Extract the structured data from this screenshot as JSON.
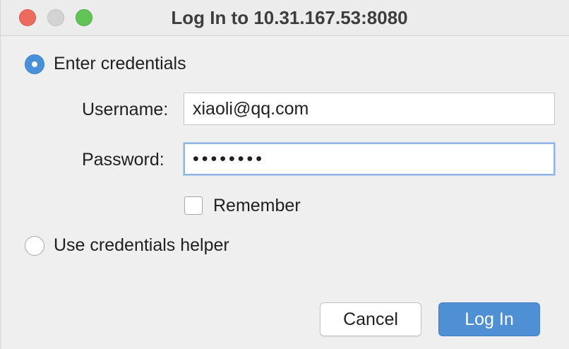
{
  "window": {
    "title": "Log In to 10.31.167.53:8080"
  },
  "auth_mode": {
    "enter_credentials_label": "Enter credentials",
    "enter_credentials_selected": true,
    "helper_label": "Use credentials helper",
    "helper_selected": false
  },
  "form": {
    "username_label": "Username:",
    "username_value": "xiaoli@qq.com",
    "password_label": "Password:",
    "password_value": "••••••••",
    "remember_label": "Remember",
    "remember_checked": false
  },
  "buttons": {
    "cancel_label": "Cancel",
    "login_label": "Log In"
  },
  "colors": {
    "accent": "#4f8fd4",
    "close": "#ed6a5e",
    "minimize": "#d3d3d3",
    "maximize": "#61c454"
  },
  "icons": {
    "close": "close-icon",
    "minimize": "minimize-icon",
    "maximize": "maximize-icon"
  }
}
